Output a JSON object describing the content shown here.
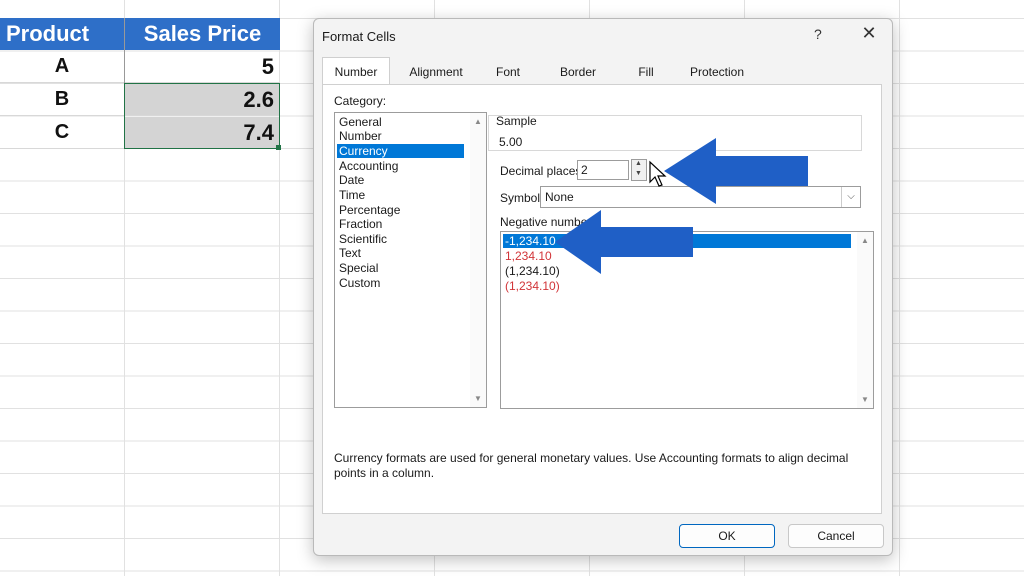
{
  "sheet": {
    "headers": [
      "Product",
      "Sales Price"
    ],
    "rows": [
      {
        "product": "A",
        "price": "5"
      },
      {
        "product": "B",
        "price": "2.6"
      },
      {
        "product": "C",
        "price": "7.4"
      }
    ],
    "header_color": "#2e6fc8",
    "selection_color": "#d4d4d4"
  },
  "dialog": {
    "title": "Format Cells",
    "help_label": "?",
    "close_label": "✕",
    "tabs": [
      "Number",
      "Alignment",
      "Font",
      "Border",
      "Fill",
      "Protection"
    ],
    "active_tab": "Number",
    "category_label": "Category:",
    "categories": [
      "General",
      "Number",
      "Currency",
      "Accounting",
      "Date",
      "Time",
      "Percentage",
      "Fraction",
      "Scientific",
      "Text",
      "Special",
      "Custom"
    ],
    "selected_category": "Currency",
    "sample_label": "Sample",
    "sample_value": "5.00",
    "decimal_label": "Decimal places:",
    "decimal_value": "2",
    "symbol_label": "Symbol:",
    "symbol_value": "None",
    "negative_label": "Negative numbers:",
    "negative_options": [
      {
        "text": "-1,234.10",
        "color": "#ffffff",
        "selected": true
      },
      {
        "text": "1,234.10",
        "color": "#d13438",
        "selected": false
      },
      {
        "text": "(1,234.10)",
        "color": "#1a1a1a",
        "selected": false
      },
      {
        "text": "(1,234.10)",
        "color": "#d13438",
        "selected": false
      }
    ],
    "description": "Currency formats are used for general monetary values.  Use Accounting formats to align decimal points in a column.",
    "ok_label": "OK",
    "cancel_label": "Cancel",
    "accent_color": "#0078d7",
    "arrow_color": "#1f5fc6"
  }
}
